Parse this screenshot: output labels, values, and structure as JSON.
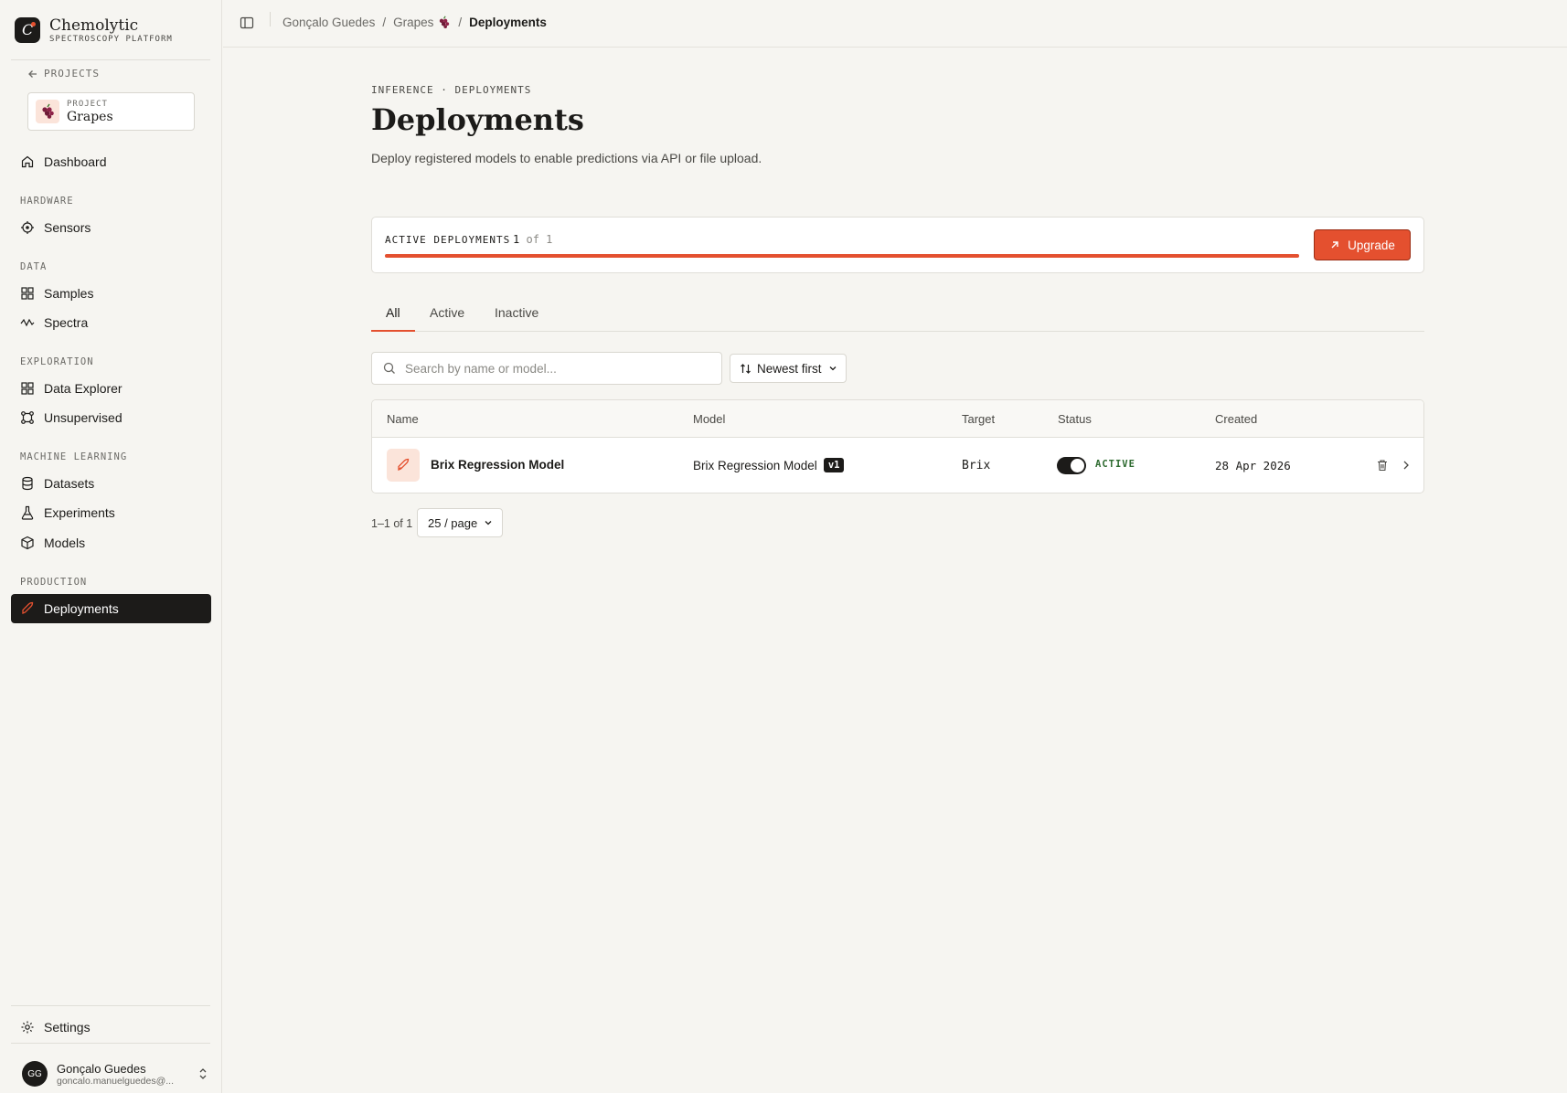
{
  "brand": {
    "name": "Chemolytic",
    "subtitle": "SPECTROSCOPY PLATFORM"
  },
  "sidebar": {
    "back_label": "PROJECTS",
    "project": {
      "label": "PROJECT",
      "name": "Grapes",
      "icon": "grapes-icon"
    },
    "dashboard": "Dashboard",
    "sections": {
      "hardware": "HARDWARE",
      "data": "DATA",
      "exploration": "EXPLORATION",
      "machine_learning": "MACHINE LEARNING",
      "production": "PRODUCTION"
    },
    "items": {
      "sensors": "Sensors",
      "samples": "Samples",
      "spectra": "Spectra",
      "data_explorer": "Data Explorer",
      "unsupervised": "Unsupervised",
      "datasets": "Datasets",
      "experiments": "Experiments",
      "models": "Models",
      "deployments": "Deployments"
    },
    "settings": "Settings",
    "user": {
      "initials": "GG",
      "name": "Gonçalo Guedes",
      "email": "goncalo.manuelguedes@..."
    }
  },
  "breadcrumb": {
    "user": "Gonçalo Guedes",
    "project": "Grapes",
    "current": "Deployments",
    "separator": "/"
  },
  "page": {
    "eyebrow": "INFERENCE · DEPLOYMENTS",
    "title": "Deployments",
    "subtitle": "Deploy registered models to enable predictions via API or file upload."
  },
  "quota": {
    "label": "ACTIVE DEPLOYMENTS",
    "used": "1",
    "total_text": "of 1",
    "fraction": 1.0,
    "upgrade_label": "Upgrade"
  },
  "tabs": {
    "all": "All",
    "active": "Active",
    "inactive": "Inactive",
    "selected": "All"
  },
  "search": {
    "placeholder": "Search by name or model...",
    "value": ""
  },
  "sort": {
    "label": "Newest first"
  },
  "table": {
    "columns": {
      "name": "Name",
      "model": "Model",
      "target": "Target",
      "status": "Status",
      "created": "Created"
    },
    "rows": [
      {
        "name": "Brix Regression Model",
        "model": "Brix Regression Model",
        "version": "v1",
        "target": "Brix",
        "enabled": true,
        "status": "ACTIVE",
        "created": "28 Apr 2026"
      }
    ]
  },
  "pagination": {
    "range": "1–1 of 1",
    "page_size": "25 / page"
  },
  "colors": {
    "accent": "#e4502f",
    "dark": "#1c1b19",
    "background": "#f6f5f1",
    "status_active": "#2d6a2f"
  }
}
